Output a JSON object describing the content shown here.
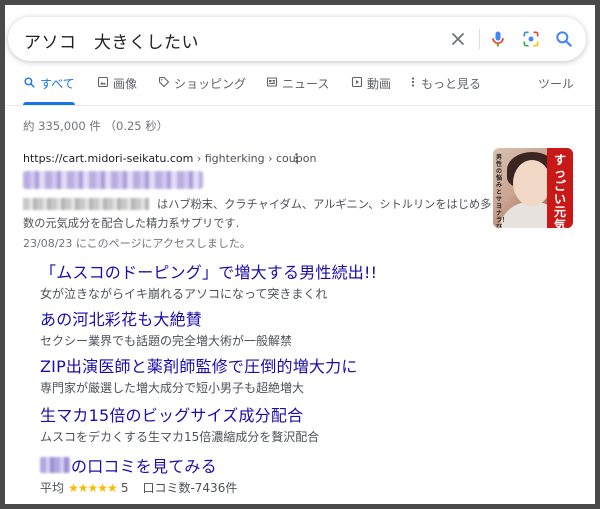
{
  "search": {
    "query": "アソコ　大きくしたい"
  },
  "tabs": [
    {
      "label": "すべて",
      "icon": "search-icon",
      "active": true
    },
    {
      "label": "画像",
      "icon": "image-icon"
    },
    {
      "label": "ショッピング",
      "icon": "tag-icon"
    },
    {
      "label": "ニュース",
      "icon": "news-icon"
    },
    {
      "label": "動画",
      "icon": "video-icon"
    },
    {
      "label": "もっと見る",
      "icon": "more-vertical-icon"
    }
  ],
  "tools_label": "ツール",
  "result_stats": "約 335,000 件 （0.25 秒）",
  "result": {
    "url_host": "https://cart.midori-seikatu.com",
    "url_path": " › fighterking › coupon",
    "more_icon": "more-vertical-icon",
    "snippet": "はハブ粉末、クラチャイダム、アルギニン、シトルリンをはじめ多数の元気成分を配合した精力系サプリです.",
    "visited": "23/08/23 にこのページにアクセスしました。",
    "thumbnail_text": "すっごい元気",
    "thumbnail_side_text": "男性の悩みとサヨナラ！ びっくり"
  },
  "sitelinks": [
    {
      "title": "「ムスコのドーピング」で増大する男性続出!!",
      "desc": "女が泣きながらイキ崩れるアソコになって突きまくれ"
    },
    {
      "title": "あの河北彩花も大絶賛",
      "desc": "セクシー業界でも話題の完全増大術が一般解禁"
    },
    {
      "title": "ZIP出演医師と薬剤師監修で圧倒的増大力に",
      "desc": "専門家が厳選した増大成分で短小男子も超絶増大"
    },
    {
      "title": "生マカ15倍のビッグサイズ成分配合",
      "desc": "ムスコをデカくする生マカ15倍濃縮成分を贅沢配合"
    },
    {
      "title": "の口コミを見てみる",
      "rating_label": "平均",
      "stars": "★★★★★",
      "rating_value": "5",
      "review_count": "口コミ数-7436件"
    }
  ],
  "colors": {
    "link": "#1a0dab",
    "active_tab": "#1a73e8",
    "star": "#fbbc04"
  }
}
